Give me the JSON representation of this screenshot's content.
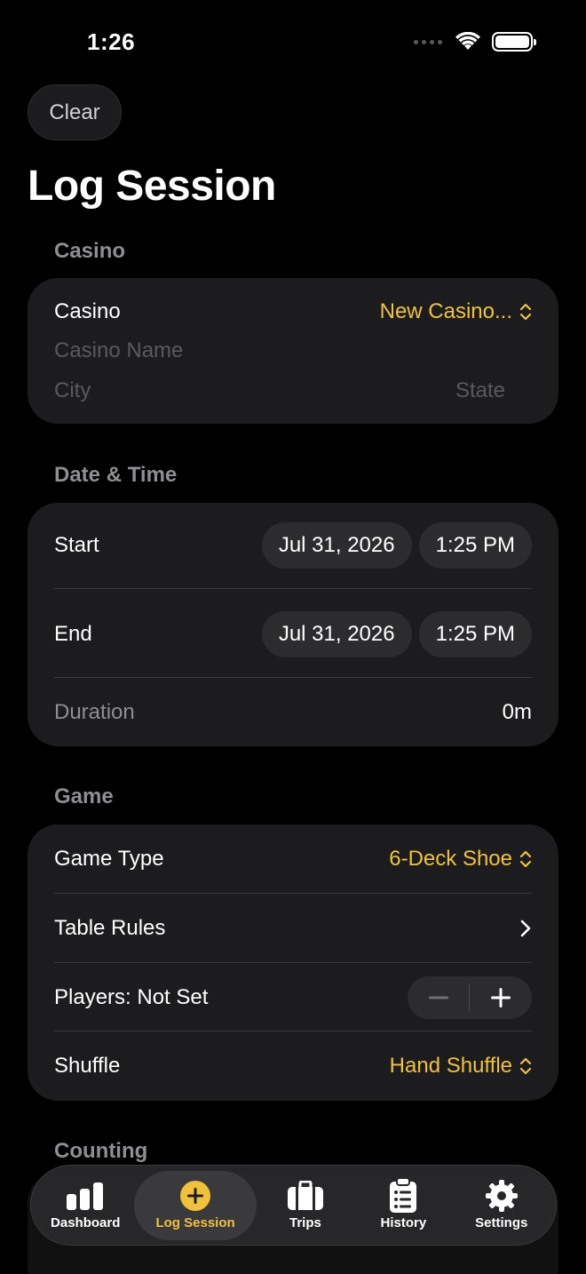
{
  "status": {
    "time": "1:26"
  },
  "header": {
    "clear_label": "Clear",
    "title": "Log Session"
  },
  "casino": {
    "section_label": "Casino",
    "row_label": "Casino",
    "picker_value": "New Casino...",
    "name_placeholder": "Casino Name",
    "city_placeholder": "City",
    "state_placeholder": "State"
  },
  "datetime": {
    "section_label": "Date & Time",
    "start_label": "Start",
    "start_date": "Jul 31, 2026",
    "start_time": "1:25 PM",
    "end_label": "End",
    "end_date": "Jul 31, 2026",
    "end_time": "1:25 PM",
    "duration_label": "Duration",
    "duration_value": "0m"
  },
  "game": {
    "section_label": "Game",
    "game_type_label": "Game Type",
    "game_type_value": "6-Deck Shoe",
    "table_rules_label": "Table Rules",
    "players_label": "Players: Not Set",
    "shuffle_label": "Shuffle",
    "shuffle_value": "Hand Shuffle"
  },
  "counting": {
    "section_label": "Counting"
  },
  "tabbar": {
    "tabs": [
      {
        "label": "Dashboard",
        "icon": "bar-chart-icon"
      },
      {
        "label": "Log Session",
        "icon": "plus-circle-icon"
      },
      {
        "label": "Trips",
        "icon": "suitcase-icon"
      },
      {
        "label": "History",
        "icon": "clipboard-list-icon"
      },
      {
        "label": "Settings",
        "icon": "gear-icon"
      }
    ],
    "active_index": 1
  },
  "colors": {
    "accent": "#f0c23a",
    "background": "#000000",
    "card": "#1c1c1e"
  }
}
